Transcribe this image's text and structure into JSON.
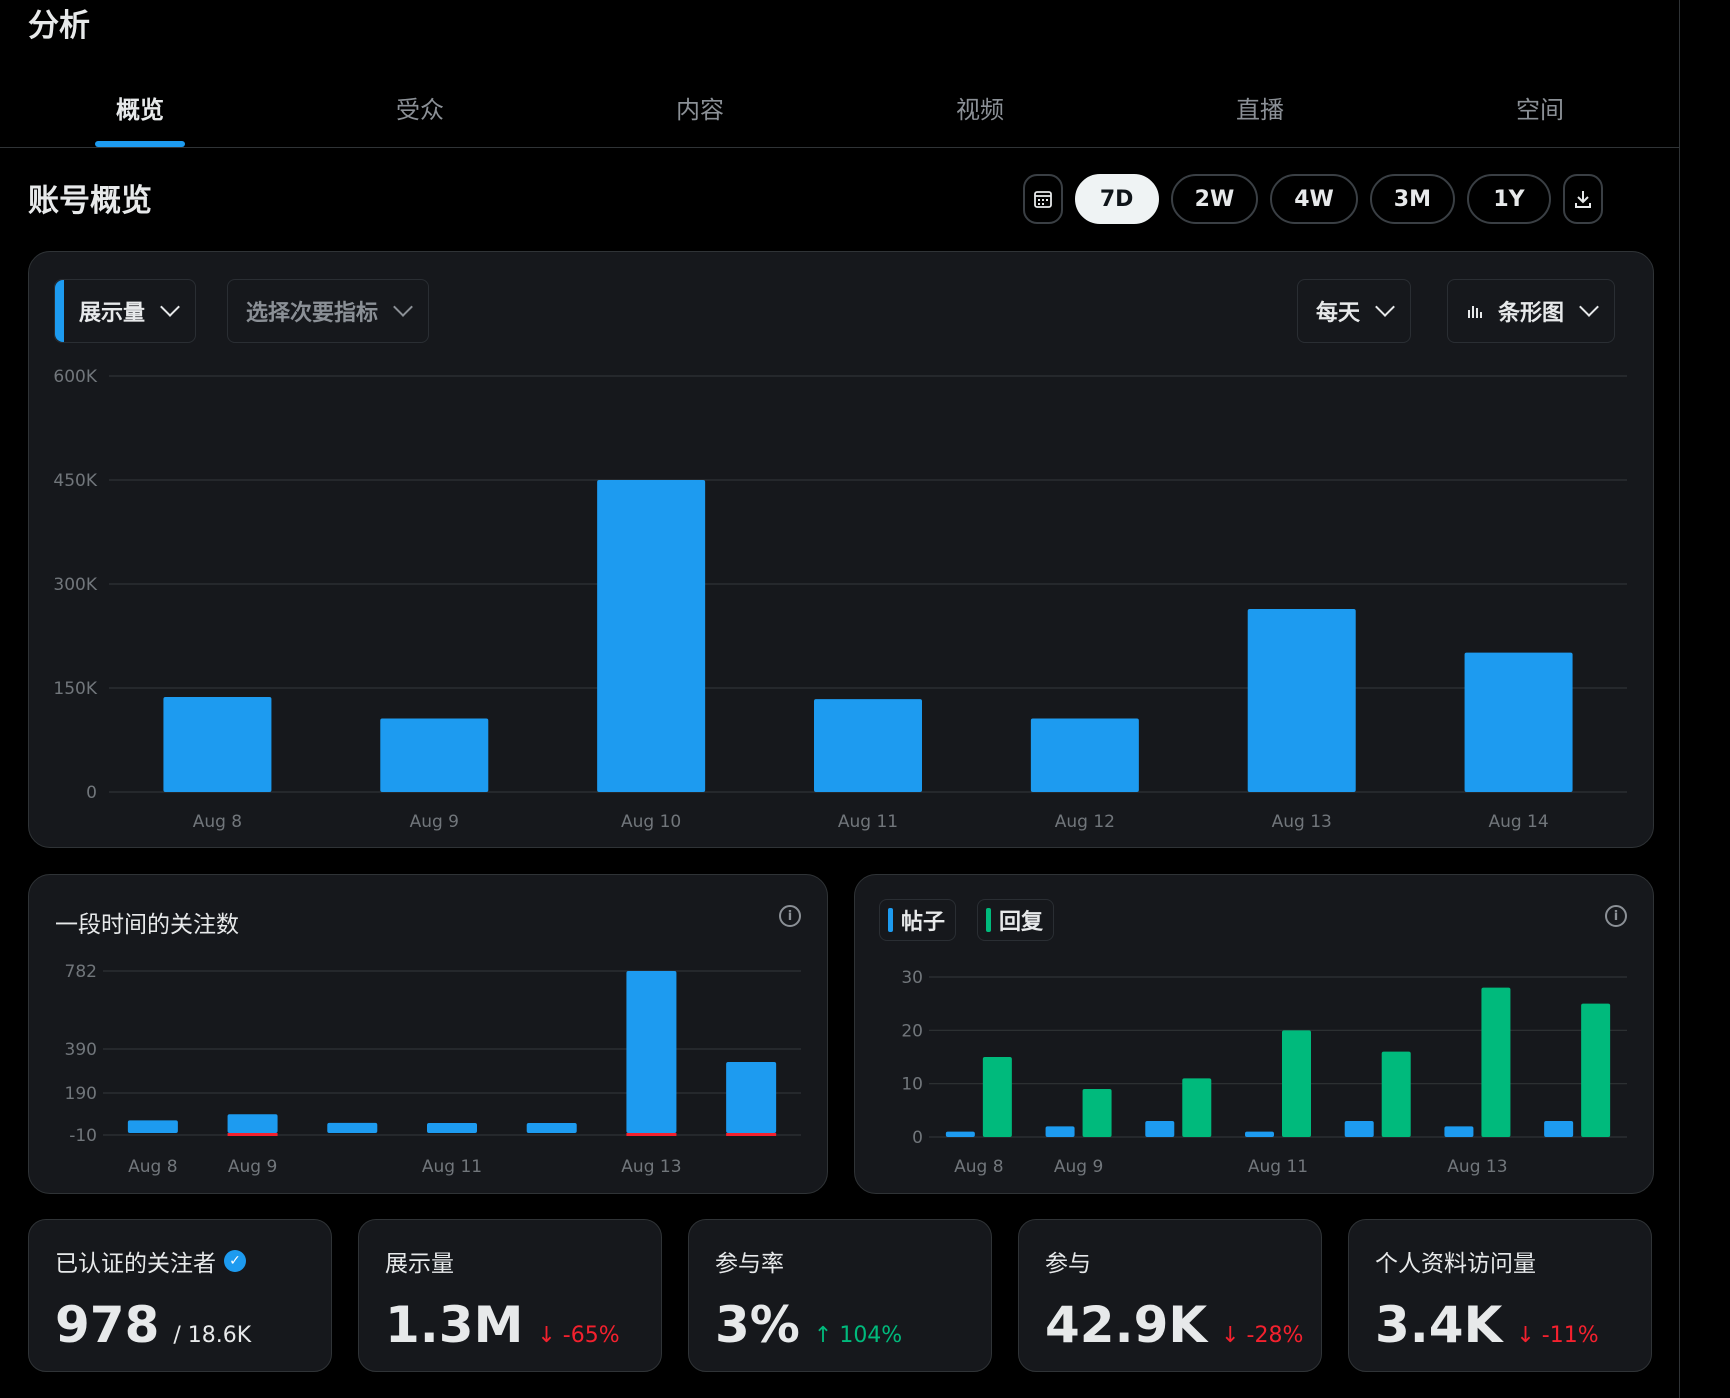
{
  "page_title": "分析",
  "tabs": [
    "概览",
    "受众",
    "内容",
    "视频",
    "直播",
    "空间"
  ],
  "active_tab": "概览",
  "section_title": "账号概览",
  "range_options": [
    "7D",
    "2W",
    "4W",
    "3M",
    "1Y"
  ],
  "active_range": "7D",
  "toolbar": {
    "primary_metric": "展示量",
    "secondary_metric": "选择次要指标",
    "granularity": "每天",
    "chart_type": "条形图"
  },
  "colors": {
    "accent_blue": "#1d9bf0",
    "accent_green": "#00ba7c",
    "negative": "#f4212e"
  },
  "chart_data": [
    {
      "type": "bar",
      "categories": [
        "Aug 8",
        "Aug 9",
        "Aug 10",
        "Aug 11",
        "Aug 12",
        "Aug 13",
        "Aug 14"
      ],
      "values": [
        137000,
        106000,
        450000,
        134000,
        106000,
        264000,
        201000
      ],
      "ylim": [
        0,
        600000
      ],
      "yticks": [
        "600K",
        "450K",
        "300K",
        "150K",
        "0"
      ],
      "ytick_values": [
        600000,
        450000,
        300000,
        150000,
        0
      ],
      "grid": true
    },
    {
      "type": "bar",
      "title": "一段时间的关注数",
      "categories": [
        "Aug 8",
        "Aug 9",
        "Aug 10",
        "Aug 11",
        "Aug 12",
        "Aug 13",
        "Aug 14"
      ],
      "xtick_labels": [
        "Aug 8",
        "Aug 9",
        "",
        "Aug 11",
        "",
        "Aug 13",
        ""
      ],
      "values": [
        35,
        52,
        28,
        25,
        25,
        782,
        330
      ],
      "negative_values": [
        0,
        -3,
        0,
        0,
        0,
        -5,
        -5
      ],
      "ylim": [
        -10,
        782
      ],
      "yticks": [
        "782",
        "390",
        "190",
        "-10"
      ],
      "ytick_values": [
        782,
        390,
        190,
        -10
      ],
      "grid": true
    },
    {
      "type": "bar",
      "categories": [
        "Aug 8",
        "Aug 9",
        "Aug 10",
        "Aug 11",
        "Aug 12",
        "Aug 13",
        "Aug 14"
      ],
      "xtick_labels": [
        "Aug 8",
        "Aug 9",
        "",
        "Aug 11",
        "",
        "Aug 13",
        ""
      ],
      "series": [
        {
          "name": "帖子",
          "color": "#1d9bf0",
          "values": [
            1,
            2,
            3,
            1,
            3,
            2,
            3
          ]
        },
        {
          "name": "回复",
          "color": "#00ba7c",
          "values": [
            15,
            9,
            11,
            20,
            16,
            28,
            25
          ]
        }
      ],
      "ylim": [
        0,
        30
      ],
      "yticks": [
        "30",
        "20",
        "10",
        "0"
      ],
      "ytick_values": [
        30,
        20,
        10,
        0
      ],
      "grid": true
    }
  ],
  "stats": [
    {
      "label": "已认证的关注者",
      "value": "978",
      "sub": "/ 18.6K",
      "delta": "",
      "verified": true
    },
    {
      "label": "展示量",
      "value": "1.3M",
      "sub": "",
      "delta": "↓ -65%",
      "direction": "down"
    },
    {
      "label": "参与率",
      "value": "3%",
      "sub": "",
      "delta": "↑ 104%",
      "direction": "up"
    },
    {
      "label": "参与",
      "value": "42.9K",
      "sub": "",
      "delta": "↓ -28%",
      "direction": "down"
    },
    {
      "label": "个人资料访问量",
      "value": "3.4K",
      "sub": "",
      "delta": "↓ -11%",
      "direction": "down"
    }
  ]
}
